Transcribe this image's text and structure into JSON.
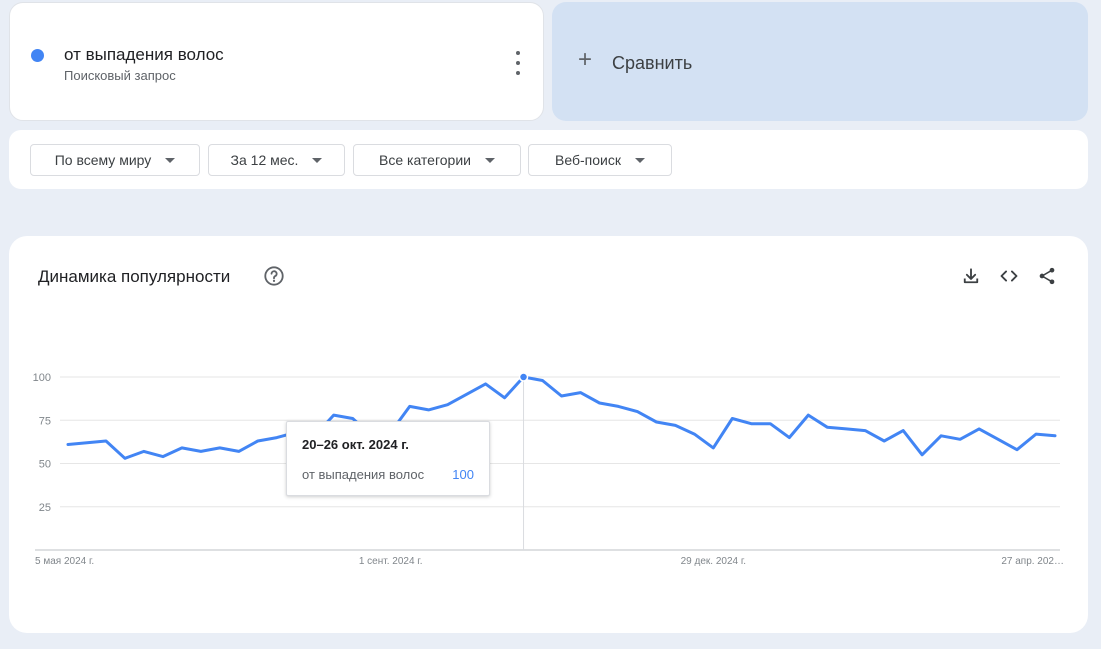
{
  "term": {
    "title": "от выпадения волос",
    "subtitle": "Поисковый запрос",
    "color": "#4285f4",
    "menu_icon": "more-vert-icon"
  },
  "compare": {
    "label": "Сравнить",
    "icon": "plus-icon"
  },
  "filters": [
    {
      "label": "По всему миру"
    },
    {
      "label": "За 12 мес."
    },
    {
      "label": "Все категории"
    },
    {
      "label": "Веб-поиск"
    }
  ],
  "chart_card": {
    "title": "Динамика популярности",
    "help_icon": "help-circle-icon",
    "tools": [
      "download-icon",
      "embed-code-icon",
      "share-icon"
    ]
  },
  "tooltip": {
    "date": "20–26 окт. 2024 г.",
    "term": "от выпадения волос",
    "value": "100"
  },
  "chart_data": {
    "type": "line",
    "title": "Динамика популярности",
    "xlabel": "",
    "ylabel": "",
    "ylim": [
      0,
      100
    ],
    "yticks": [
      25,
      50,
      75,
      100
    ],
    "grid": true,
    "x_tick_labels": [
      {
        "label": "5 мая 2024 г.",
        "index": 0
      },
      {
        "label": "1 сент. 2024 г.",
        "index": 17
      },
      {
        "label": "29 дек. 2024 г.",
        "index": 34
      },
      {
        "label": "27 апр. 202…",
        "index": 51
      }
    ],
    "highlight_index": 24,
    "series": [
      {
        "name": "от выпадения волос",
        "color": "#4285f4",
        "values": [
          61,
          62,
          63,
          53,
          57,
          54,
          59,
          57,
          59,
          57,
          63,
          65,
          68,
          66,
          78,
          76,
          66,
          68,
          83,
          81,
          84,
          90,
          96,
          88,
          100,
          98,
          89,
          91,
          85,
          83,
          80,
          74,
          72,
          67,
          59,
          76,
          73,
          73,
          65,
          78,
          71,
          70,
          69,
          63,
          69,
          55,
          66,
          64,
          70,
          64,
          58,
          67,
          66
        ]
      }
    ]
  }
}
